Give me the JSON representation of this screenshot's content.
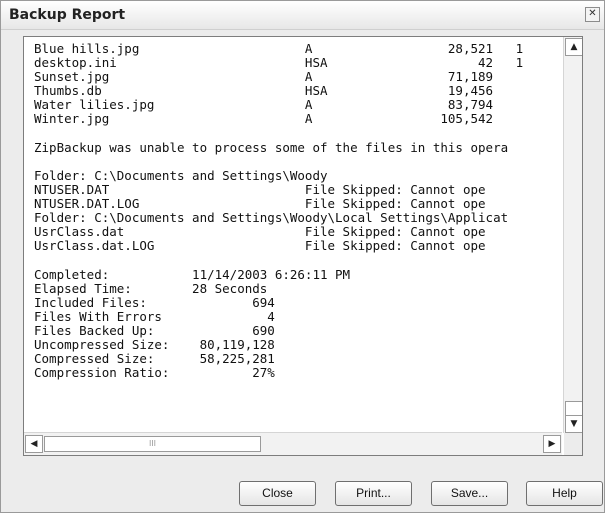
{
  "window": {
    "title": "Backup Report",
    "close_glyph": "✕"
  },
  "report": {
    "lines": [
      "Blue hills.jpg                      A                  28,521   1",
      "desktop.ini                         HSA                    42   1",
      "Sunset.jpg                          A                  71,189",
      "Thumbs.db                           HSA                19,456",
      "Water lilies.jpg                    A                  83,794",
      "Winter.jpg                          A                 105,542",
      "",
      "ZipBackup was unable to process some of the files in this opera",
      "",
      "Folder: C:\\Documents and Settings\\Woody",
      "NTUSER.DAT                          File Skipped: Cannot ope",
      "NTUSER.DAT.LOG                      File Skipped: Cannot ope",
      "Folder: C:\\Documents and Settings\\Woody\\Local Settings\\Applicat",
      "UsrClass.dat                        File Skipped: Cannot ope",
      "UsrClass.dat.LOG                    File Skipped: Cannot ope",
      "",
      "Completed:           11/14/2003 6:26:11 PM",
      "Elapsed Time:        28 Seconds",
      "Included Files:              694",
      "Files With Errors              4",
      "Files Backed Up:             690",
      "Uncompressed Size:    80,119,128",
      "Compressed Size:      58,225,281",
      "Compression Ratio:           27%"
    ]
  },
  "scrollbars": {
    "up_glyph": "▲",
    "down_glyph": "▼",
    "left_glyph": "◀",
    "right_glyph": "▶",
    "grip_glyph": "III"
  },
  "buttons": {
    "close": "Close",
    "print": "Print...",
    "save": "Save...",
    "help": "Help"
  },
  "icons": {
    "close": "close-icon",
    "scroll_up": "chevron-up-icon",
    "scroll_down": "chevron-down-icon",
    "scroll_left": "chevron-left-icon",
    "scroll_right": "chevron-right-icon"
  }
}
